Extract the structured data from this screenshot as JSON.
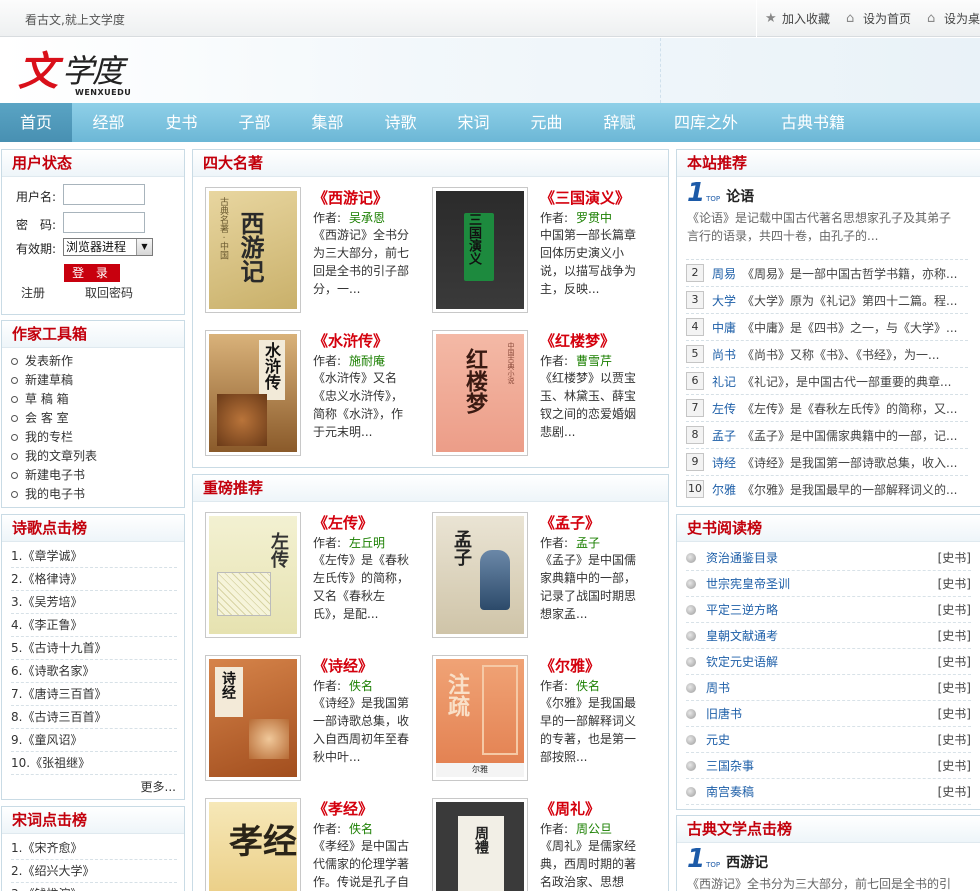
{
  "topbar": {
    "slogan": "看古文,就上文学度",
    "links": [
      "加入收藏",
      "设为首页",
      "设为桌"
    ]
  },
  "logo": {
    "char1": "文",
    "char23": "学度",
    "en": "WENXUEDU"
  },
  "nav": [
    "首页",
    "经部",
    "史书",
    "子部",
    "集部",
    "诗歌",
    "宋词",
    "元曲",
    "辞赋",
    "四库之外",
    "古典书籍"
  ],
  "user_status": {
    "title": "用户状态",
    "username_label": "用户名:",
    "password_label": "密　码:",
    "validity_label": "有效期:",
    "validity_value": "浏览器进程",
    "login_button": "登 录",
    "register": "注册",
    "retrieve": "取回密码"
  },
  "writer_tools": {
    "title": "作家工具箱",
    "items": [
      "发表新作",
      "新建草稿",
      "草 稿 箱",
      "会 客 室",
      "我的专栏",
      "我的文章列表",
      "新建电子书",
      "我的电子书"
    ]
  },
  "poetry_rank": {
    "title": "诗歌点击榜",
    "items": [
      "1.《章学诚》",
      "2.《格律诗》",
      "3.《吴芳培》",
      "4.《李正鲁》",
      "5.《古诗十九首》",
      "6.《诗歌名家》",
      "7.《唐诗三百首》",
      "8.《古诗三百首》",
      "9.《童风诏》",
      "10.《张祖继》"
    ],
    "more": "更多..."
  },
  "songci_rank": {
    "title": "宋词点击榜",
    "items": [
      "1.《宋齐愈》",
      "2.《绍兴大学》",
      "3.《钱惟演》"
    ]
  },
  "four_classics": {
    "title": "四大名著",
    "books": [
      {
        "title": "《西游记》",
        "author_label": "作者:",
        "author": "吴承恩",
        "desc": "《西游记》全书分为三大部分，前七回是全书的引子部分，一..."
      },
      {
        "title": "《三国演义》",
        "author_label": "作者:",
        "author": "罗贯中",
        "desc": "中国第一部长篇章回体历史演义小说，以描写战争为主，反映..."
      },
      {
        "title": "《水浒传》",
        "author_label": "作者:",
        "author": "施耐庵",
        "desc": "《水浒传》又名《忠义水浒传》，简称《水浒》，作于元末明..."
      },
      {
        "title": "《红楼梦》",
        "author_label": "作者:",
        "author": "曹雪芹",
        "desc": "《红楼梦》以贾宝玉、林黛玉、薛宝钗之间的恋爱婚姻悲剧..."
      }
    ]
  },
  "heavy_recommend": {
    "title": "重磅推荐",
    "books": [
      {
        "title": "《左传》",
        "author_label": "作者:",
        "author": "左丘明",
        "desc": "《左传》是《春秋左氏传》的简称，又名《春秋左氏》，是配..."
      },
      {
        "title": "《孟子》",
        "author_label": "作者:",
        "author": "孟子",
        "desc": "《孟子》是中国儒家典籍中的一部，记录了战国时期思想家孟..."
      },
      {
        "title": "《诗经》",
        "author_label": "作者:",
        "author": "佚名",
        "desc": "《诗经》是我国第一部诗歌总集，收入自西周初年至春秋中叶..."
      },
      {
        "title": "《尔雅》",
        "author_label": "作者:",
        "author": "佚名",
        "desc": "《尔雅》是我国最早的一部解释词义的专著，也是第一部按照..."
      },
      {
        "title": "《孝经》",
        "author_label": "作者:",
        "author": "佚名",
        "desc": "《孝经》是中国古代儒家的伦理学著作。传说是孔子自"
      },
      {
        "title": "《周礼》",
        "author_label": "作者:",
        "author": "周公旦",
        "desc": "《周礼》是儒家经典，西周时期的著名政治家、思想"
      }
    ]
  },
  "site_recommend": {
    "title": "本站推荐",
    "top_num": "1",
    "top_tag": "TOP",
    "top_name": "论语",
    "top_desc": "《论语》是记载中国古代著名思想家孔子及其弟子言行的语录，共四十卷，由孔子的...",
    "items": [
      {
        "num": "2",
        "name": "周易",
        "desc": "《周易》是一部中国古哲学书籍，亦称..."
      },
      {
        "num": "3",
        "name": "大学",
        "desc": "《大学》原为《礼记》第四十二篇。程..."
      },
      {
        "num": "4",
        "name": "中庸",
        "desc": "《中庸》是《四书》之一，与《大学》..."
      },
      {
        "num": "5",
        "name": "尚书",
        "desc": "《尚书》又称《书》、《书经》，为一..."
      },
      {
        "num": "6",
        "name": "礼记",
        "desc": "《礼记》，是中国古代一部重要的典章..."
      },
      {
        "num": "7",
        "name": "左传",
        "desc": "《左传》是《春秋左氏传》的简称，又..."
      },
      {
        "num": "8",
        "name": "孟子",
        "desc": "《孟子》是中国儒家典籍中的一部，记..."
      },
      {
        "num": "9",
        "name": "诗经",
        "desc": "《诗经》是我国第一部诗歌总集，收入..."
      },
      {
        "num": "10",
        "name": "尔雅",
        "desc": "《尔雅》是我国最早的一部解释词义的..."
      }
    ]
  },
  "history_rank": {
    "title": "史书阅读榜",
    "tag": "[史书]",
    "items": [
      "资治通鉴目录",
      "世宗宪皇帝圣训",
      "平定三逆方略",
      "皇朝文献通考",
      "钦定元史语解",
      "周书",
      "旧唐书",
      "元史",
      "三国杂事",
      "南宫奏稿"
    ]
  },
  "classic_rank": {
    "title": "古典文学点击榜",
    "top_num": "1",
    "top_tag": "TOP",
    "top_name": "西游记",
    "top_desc": "《西游记》全书分为三大部分，前七回是全书的引"
  },
  "cover_text": {
    "xiyouji": "西游记",
    "sanguo": "三国演义",
    "shuihu": "水浒传",
    "honglou": "红楼梦",
    "zuozhuan": "左传",
    "mengzi": "孟子",
    "shijing": "诗经",
    "erya": "注疏",
    "erya_sub": "尔雅",
    "xiaojing": "孝经",
    "zhouli": "周禮"
  },
  "colors": {
    "accent": "#c3000c",
    "nav": "#6cb7d6",
    "link": "#1e5fa8",
    "author": "#1a7f00"
  }
}
